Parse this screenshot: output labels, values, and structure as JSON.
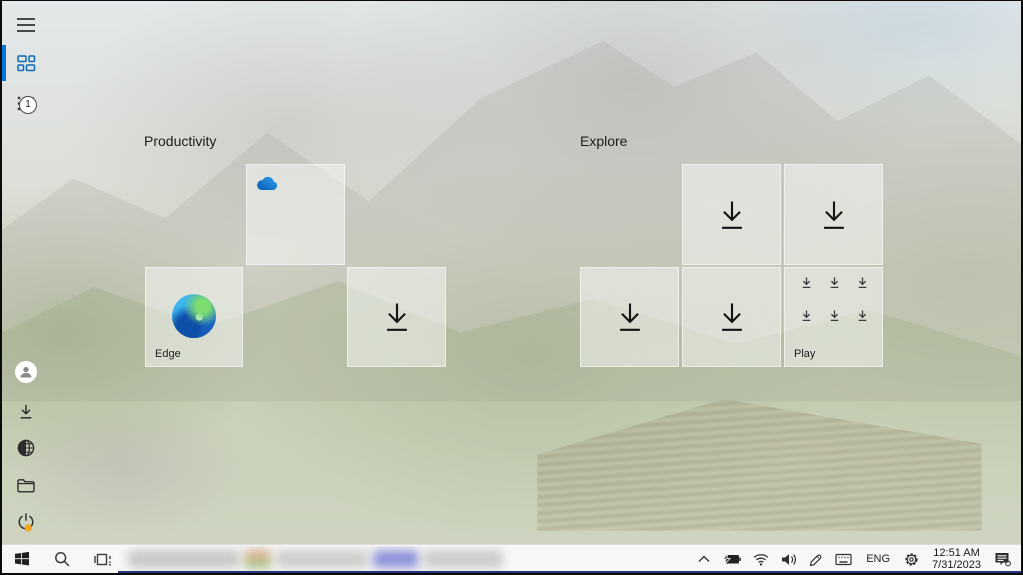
{
  "sidebar": {
    "all_apps_badge": "1"
  },
  "start": {
    "groups": [
      {
        "label": "Productivity"
      },
      {
        "label": "Explore"
      }
    ],
    "edge_label": "Edge",
    "play_label": "Play"
  },
  "taskbar": {
    "language": "ENG",
    "time": "12:51 AM",
    "date": "7/31/2023"
  },
  "colors": {
    "accent_blue": "#0078d7",
    "power_badge_orange": "#f5a623",
    "onedrive_blue": "#0d6cbd",
    "taskbar_underline_navy": "#26357b"
  }
}
